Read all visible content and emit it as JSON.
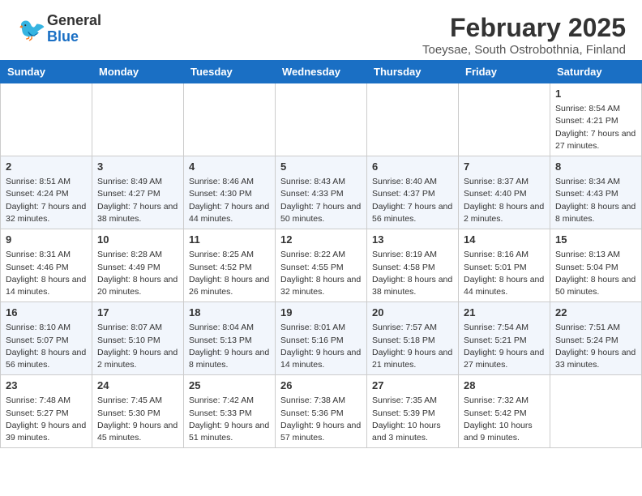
{
  "header": {
    "logo_line1": "General",
    "logo_line2": "Blue",
    "month_year": "February 2025",
    "location": "Toeysae, South Ostrobothnia, Finland"
  },
  "weekdays": [
    "Sunday",
    "Monday",
    "Tuesday",
    "Wednesday",
    "Thursday",
    "Friday",
    "Saturday"
  ],
  "weeks": [
    [
      {
        "day": "",
        "info": ""
      },
      {
        "day": "",
        "info": ""
      },
      {
        "day": "",
        "info": ""
      },
      {
        "day": "",
        "info": ""
      },
      {
        "day": "",
        "info": ""
      },
      {
        "day": "",
        "info": ""
      },
      {
        "day": "1",
        "info": "Sunrise: 8:54 AM\nSunset: 4:21 PM\nDaylight: 7 hours\nand 27 minutes."
      }
    ],
    [
      {
        "day": "2",
        "info": "Sunrise: 8:51 AM\nSunset: 4:24 PM\nDaylight: 7 hours\nand 32 minutes."
      },
      {
        "day": "3",
        "info": "Sunrise: 8:49 AM\nSunset: 4:27 PM\nDaylight: 7 hours\nand 38 minutes."
      },
      {
        "day": "4",
        "info": "Sunrise: 8:46 AM\nSunset: 4:30 PM\nDaylight: 7 hours\nand 44 minutes."
      },
      {
        "day": "5",
        "info": "Sunrise: 8:43 AM\nSunset: 4:33 PM\nDaylight: 7 hours\nand 50 minutes."
      },
      {
        "day": "6",
        "info": "Sunrise: 8:40 AM\nSunset: 4:37 PM\nDaylight: 7 hours\nand 56 minutes."
      },
      {
        "day": "7",
        "info": "Sunrise: 8:37 AM\nSunset: 4:40 PM\nDaylight: 8 hours\nand 2 minutes."
      },
      {
        "day": "8",
        "info": "Sunrise: 8:34 AM\nSunset: 4:43 PM\nDaylight: 8 hours\nand 8 minutes."
      }
    ],
    [
      {
        "day": "9",
        "info": "Sunrise: 8:31 AM\nSunset: 4:46 PM\nDaylight: 8 hours\nand 14 minutes."
      },
      {
        "day": "10",
        "info": "Sunrise: 8:28 AM\nSunset: 4:49 PM\nDaylight: 8 hours\nand 20 minutes."
      },
      {
        "day": "11",
        "info": "Sunrise: 8:25 AM\nSunset: 4:52 PM\nDaylight: 8 hours\nand 26 minutes."
      },
      {
        "day": "12",
        "info": "Sunrise: 8:22 AM\nSunset: 4:55 PM\nDaylight: 8 hours\nand 32 minutes."
      },
      {
        "day": "13",
        "info": "Sunrise: 8:19 AM\nSunset: 4:58 PM\nDaylight: 8 hours\nand 38 minutes."
      },
      {
        "day": "14",
        "info": "Sunrise: 8:16 AM\nSunset: 5:01 PM\nDaylight: 8 hours\nand 44 minutes."
      },
      {
        "day": "15",
        "info": "Sunrise: 8:13 AM\nSunset: 5:04 PM\nDaylight: 8 hours\nand 50 minutes."
      }
    ],
    [
      {
        "day": "16",
        "info": "Sunrise: 8:10 AM\nSunset: 5:07 PM\nDaylight: 8 hours\nand 56 minutes."
      },
      {
        "day": "17",
        "info": "Sunrise: 8:07 AM\nSunset: 5:10 PM\nDaylight: 9 hours\nand 2 minutes."
      },
      {
        "day": "18",
        "info": "Sunrise: 8:04 AM\nSunset: 5:13 PM\nDaylight: 9 hours\nand 8 minutes."
      },
      {
        "day": "19",
        "info": "Sunrise: 8:01 AM\nSunset: 5:16 PM\nDaylight: 9 hours\nand 14 minutes."
      },
      {
        "day": "20",
        "info": "Sunrise: 7:57 AM\nSunset: 5:18 PM\nDaylight: 9 hours\nand 21 minutes."
      },
      {
        "day": "21",
        "info": "Sunrise: 7:54 AM\nSunset: 5:21 PM\nDaylight: 9 hours\nand 27 minutes."
      },
      {
        "day": "22",
        "info": "Sunrise: 7:51 AM\nSunset: 5:24 PM\nDaylight: 9 hours\nand 33 minutes."
      }
    ],
    [
      {
        "day": "23",
        "info": "Sunrise: 7:48 AM\nSunset: 5:27 PM\nDaylight: 9 hours\nand 39 minutes."
      },
      {
        "day": "24",
        "info": "Sunrise: 7:45 AM\nSunset: 5:30 PM\nDaylight: 9 hours\nand 45 minutes."
      },
      {
        "day": "25",
        "info": "Sunrise: 7:42 AM\nSunset: 5:33 PM\nDaylight: 9 hours\nand 51 minutes."
      },
      {
        "day": "26",
        "info": "Sunrise: 7:38 AM\nSunset: 5:36 PM\nDaylight: 9 hours\nand 57 minutes."
      },
      {
        "day": "27",
        "info": "Sunrise: 7:35 AM\nSunset: 5:39 PM\nDaylight: 10 hours\nand 3 minutes."
      },
      {
        "day": "28",
        "info": "Sunrise: 7:32 AM\nSunset: 5:42 PM\nDaylight: 10 hours\nand 9 minutes."
      },
      {
        "day": "",
        "info": ""
      }
    ]
  ]
}
